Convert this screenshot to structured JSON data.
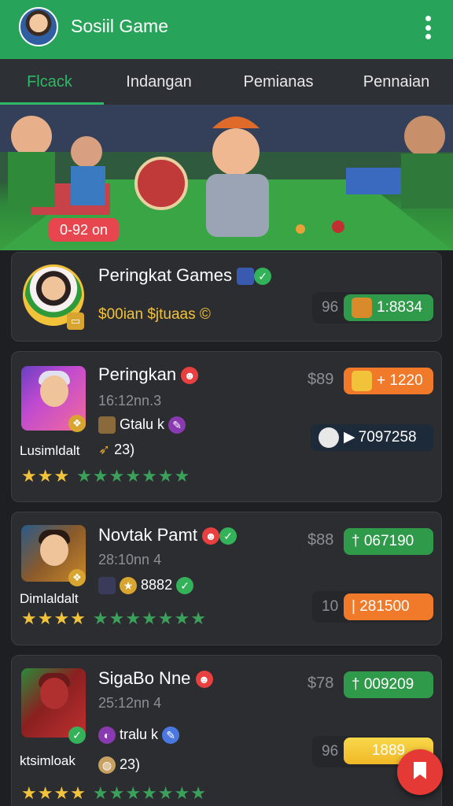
{
  "appbar": {
    "title": "Sosiil Game",
    "avatar_icon": "user-avatar",
    "menu_icon": "more-vert-icon"
  },
  "tabs": [
    {
      "label": "Flcack",
      "active": true
    },
    {
      "label": "Indangan",
      "active": false
    },
    {
      "label": "Pemianas",
      "active": false
    },
    {
      "label": "Pennaian",
      "active": false
    }
  ],
  "banner": {
    "pill": "0-92 on"
  },
  "cards": [
    {
      "title": "Peringkat Games",
      "subtitle": "$00ian $jtuaas ©",
      "count": "96",
      "chip": "1:8834",
      "chip_color": "#2f9a4a"
    },
    {
      "title": "Peringkan",
      "sub": "16:12nn.3",
      "meta1": "Gtalu k",
      "meta2": "23)",
      "left_label": "Lusimldalt",
      "price": "$89",
      "chip1": "+ 1220",
      "chip2": "7097258",
      "stars_gold": "★★★",
      "stars_green": "★★★★★★★"
    },
    {
      "title": "Novtak Pamt",
      "sub": "28:10nn 4",
      "meta1": "8882",
      "left_label": "Dimlaldalt",
      "price": "$88",
      "chip1": "† 067190",
      "count": "10",
      "chip2": "| 281500",
      "stars_gold": "★★★★",
      "stars_green": "★★★★★★★"
    },
    {
      "title": "SigaBo Nne",
      "sub": "25:12nn 4",
      "meta1": "tralu k",
      "meta2": "23)",
      "left_label": "ktsimloak",
      "price": "$78",
      "chip1": "† 009209",
      "count": "96",
      "chip2": "1889",
      "stars_gold": "★★★★",
      "stars_green": "★★★★★★★"
    }
  ],
  "fab": {
    "icon": "bookmark-icon"
  }
}
